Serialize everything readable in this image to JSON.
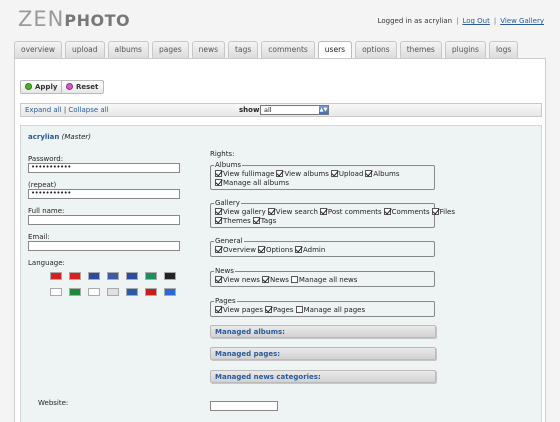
{
  "logo": {
    "part1": "ZEN",
    "part2": "PHOTO"
  },
  "header": {
    "logged_in_text": "Logged in as acrylian",
    "logout": "Log Out",
    "view_gallery": "View Gallery",
    "sep": "|"
  },
  "tabs": [
    "overview",
    "upload",
    "albums",
    "pages",
    "news",
    "tags",
    "comments",
    "users",
    "options",
    "themes",
    "plugins",
    "logs"
  ],
  "active_tab": "users",
  "toolbar": {
    "apply": "Apply",
    "reset": "Reset"
  },
  "bar": {
    "expand": "Expand all",
    "sep": "|",
    "collapse": "Collapse all",
    "show_label": "show",
    "show_value": "all"
  },
  "user": {
    "name": "acrylian",
    "role": "(Master)"
  },
  "fields": {
    "password_label": "Password:",
    "password_value": "•••••••••••",
    "repeat_label": "(repeat)",
    "repeat_value": "•••••••••••",
    "fullname_label": "Full name:",
    "email_label": "Email:",
    "language_label": "Language:",
    "website_label": "Website:"
  },
  "rights": {
    "label": "Rights:",
    "groups": [
      {
        "legend": "Albums",
        "rows": [
          [
            {
              "t": "View fullimage",
              "c": true
            },
            {
              "t": "View albums",
              "c": true
            },
            {
              "t": "Upload",
              "c": true
            },
            {
              "t": "Albums",
              "c": true
            }
          ],
          [
            {
              "t": "Manage all albums",
              "c": true
            }
          ]
        ]
      },
      {
        "legend": "Gallery",
        "rows": [
          [
            {
              "t": "View gallery",
              "c": true
            },
            {
              "t": "View search",
              "c": true
            },
            {
              "t": "Post comments",
              "c": true
            },
            {
              "t": "Comments",
              "c": true
            },
            {
              "t": "Files",
              "c": true
            }
          ],
          [
            {
              "t": "Themes",
              "c": true
            },
            {
              "t": "Tags",
              "c": true
            }
          ]
        ]
      },
      {
        "legend": "General",
        "rows": [
          [
            {
              "t": "Overview",
              "c": true
            },
            {
              "t": "Options",
              "c": true
            },
            {
              "t": "Admin",
              "c": true
            }
          ]
        ]
      },
      {
        "legend": "News",
        "rows": [
          [
            {
              "t": "View news",
              "c": true
            },
            {
              "t": "News",
              "c": true
            },
            {
              "t": "Manage all news",
              "c": false
            }
          ]
        ]
      },
      {
        "legend": "Pages",
        "rows": [
          [
            {
              "t": "View pages",
              "c": true
            },
            {
              "t": "Pages",
              "c": true
            },
            {
              "t": "Manage all pages",
              "c": false
            }
          ]
        ]
      }
    ]
  },
  "managed": [
    "Managed albums:",
    "Managed pages:",
    "Managed news categories:"
  ],
  "flags": [
    [
      "#d81e1e",
      "#d81e1e",
      "#2b4aa0",
      "#3c5aa8",
      "#2b4aa0",
      "#1a8f5a",
      "#222222"
    ],
    [
      "#ffffff",
      "#1b8a3a",
      "#ffffff",
      "#e0e0e0",
      "#2b5aa8",
      "#c81e1e",
      "#2a6ad8"
    ]
  ],
  "colors": {
    "accent": "#2a5a9a",
    "panel": "#eef3f3"
  }
}
